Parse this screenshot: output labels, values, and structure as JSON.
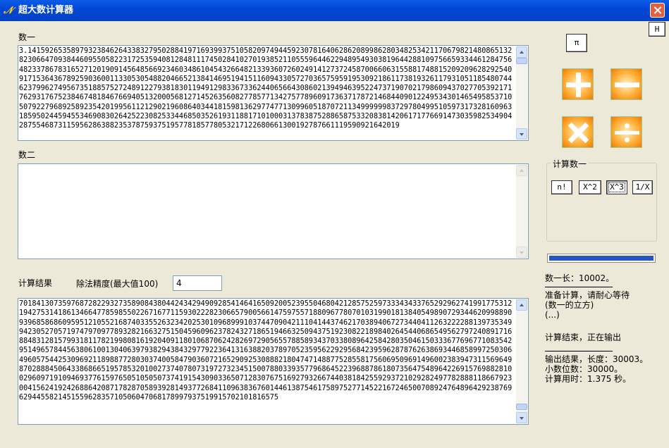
{
  "window": {
    "title": "超大数计算器"
  },
  "labels": {
    "num1": "数一",
    "num2": "数二",
    "result": "计算结果",
    "precision": "除法精度(最大值100)"
  },
  "inputs": {
    "num1_value": "3.14159265358979323846264338327950288419716939937510582097494459230781640628620899862803482534211706798214808651328230664709384460955058223172535940812848111745028410270193852110555964462294895493038196442881097566593344612847564823378678316527120190914564856692346034861045432664821339360726024914127372458700660631558817488152092096282925409171536436789259036001133053054882046652138414695194151160943305727036575959195309218611738193261179310511854807446237996274956735188575272489122793818301194912983367336244065664308602139494639522473719070217986094370277053921717629317675238467481846766940513200056812714526356082778577134275778960917363717872146844090122495343014654958537105079227968925892354201995611212902196086403441815981362977477130996051870721134999999837297804995105973173281609631859502445945534690830264252230825334468503526193118817101000313783875288658753320838142061717766914730359825349042875546873115956286388235378759375195778185778053217122680661300192787661119590921642019",
    "num2_value": "",
    "precision_value": "4"
  },
  "result_text": "701841307359768728229327358908438044243429490928541464165092005239550468042128575259733343433765292962741991775312194275314186134664778598550226716771159302228230665790056614759755718809677807010319901813840549890729344620998890939685868609595121055216874033552632342025301096899910374470904211104144374621703894067273440411263222288139735349942305270571974797097789328216632751504596096237824327186519466325094375192308221898402645440686549562797240891716884831281579931811782199808161920409118010687062428269729056557885893437033808964258428035046150333677696771083542951496578445638061001304063979382943843297792236413163882037897052359562292956842395962878762638693446858997250306496057544253096921189887728030374005847903607216529092530888218047471488775285581756069509691496002383947311569649870288845064338686651957853201002737407807319727323451500788033935779686452239688786180735647548964226915769882810029609719109469377615976505105050737419154309033650712830767516927932667440381842559293721029282497782888118667923004156241924268864208717828705893928149377268411096383676014461387546175897527714522167246500708924764896429238769629445582145155962835710506047068178997937519915702101816575",
  "log": {
    "line1": "数一长：10002。",
    "line2": "准备计算，请耐心等待",
    "line3": "(数一的立方)",
    "line4": "(...)",
    "line5": "计算结束，正在输出",
    "line6": "输出结果，长度：30003。",
    "line7": "小数位数：30000。",
    "line8": "计算用时：1.375 秒。"
  },
  "buttons": {
    "help": "H",
    "pi": "π",
    "factorial": "n!",
    "square": "X^2",
    "cube": "X^3",
    "reciprocal": "1/X"
  },
  "operations": [
    "add",
    "subtract",
    "multiply",
    "divide"
  ],
  "group": {
    "title": "计算数一"
  },
  "progress": {
    "value": 1.0,
    "color": "#2455c3"
  },
  "colors": {
    "titlebar": "#0347d6",
    "window_bg": "#ece9d8",
    "op_orange": "#ffa028"
  }
}
